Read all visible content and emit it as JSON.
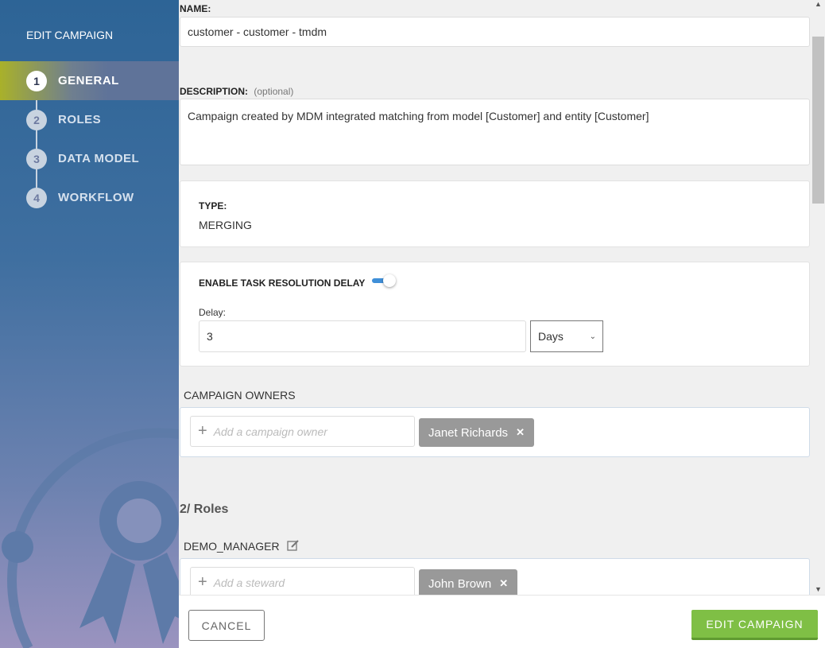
{
  "sidebar": {
    "title": "EDIT CAMPAIGN",
    "steps": [
      {
        "num": "1",
        "label": "GENERAL"
      },
      {
        "num": "2",
        "label": "ROLES"
      },
      {
        "num": "3",
        "label": "DATA MODEL"
      },
      {
        "num": "4",
        "label": "WORKFLOW"
      }
    ]
  },
  "form": {
    "name_label": "NAME:",
    "name_value": "customer - customer - tmdm",
    "desc_label": "DESCRIPTION:",
    "desc_optional": "(optional)",
    "desc_value": "Campaign created by MDM integrated matching from model [Customer] and entity [Customer]",
    "type_label": "TYPE:",
    "type_value": "MERGING",
    "delay_toggle_label": "ENABLE TASK RESOLUTION DELAY",
    "delay_enabled": true,
    "delay_label": "Delay:",
    "delay_value": "3",
    "delay_unit": "Days",
    "owners_label": "CAMPAIGN OWNERS",
    "owner_placeholder": "Add a campaign owner",
    "owners": [
      "Janet Richards"
    ],
    "roles_heading": "2/ Roles",
    "role_name": "DEMO_MANAGER",
    "steward_placeholder": "Add a steward",
    "stewards": [
      "John Brown"
    ]
  },
  "footer": {
    "cancel": "CANCEL",
    "submit": "EDIT CAMPAIGN"
  }
}
